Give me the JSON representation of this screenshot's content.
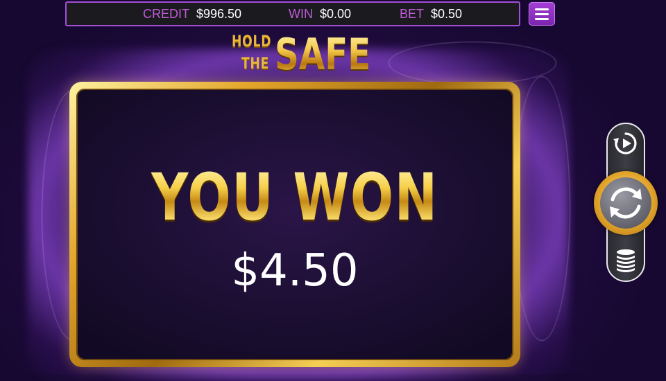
{
  "top_bar": {
    "credit_label": "CREDIT",
    "credit_value": "$996.50",
    "win_label": "WIN",
    "win_value": "$0.00",
    "bet_label": "BET",
    "bet_value": "$0.50"
  },
  "logo": {
    "line1": "HOLD",
    "line2": "THE",
    "main": "SAFE"
  },
  "win_panel": {
    "title": "YOU WON",
    "amount": "$4.50"
  },
  "controls": {
    "menu_icon": "hamburger-menu-icon",
    "autoplay_icon": "autoplay-icon",
    "spin_icon": "spin-icon",
    "bet_icon": "coin-stack-icon"
  },
  "colors": {
    "label_purple": "#c05bd8",
    "menu_purple": "#a53fd6",
    "gold": "#f0c040",
    "panel_bg": "#1c0f33"
  }
}
